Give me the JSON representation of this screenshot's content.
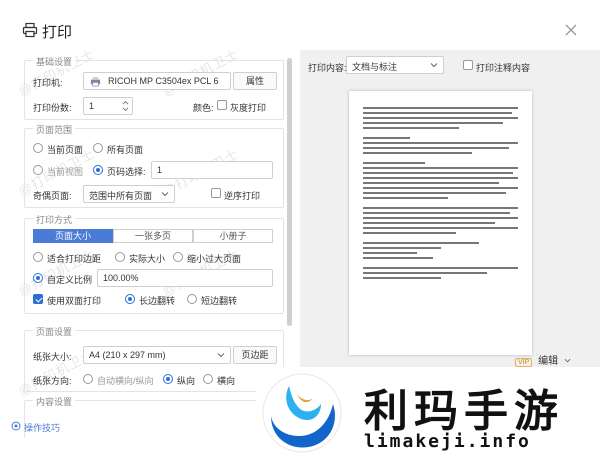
{
  "title": "打印",
  "watermark_text": "@打印机卫士",
  "basic": {
    "group_label": "基础设置",
    "printer_label": "打印机:",
    "printer_value": "RICOH MP C3504ex PCL 6",
    "properties_button": "属性",
    "copies_label": "打印份数:",
    "copies_value": "1",
    "color_label": "颜色:",
    "grayscale_label": "灰度打印",
    "grayscale_checked": false
  },
  "range": {
    "group_label": "页面范围",
    "current_page": "当前页面",
    "all_pages": "所有页面",
    "current_view": "当前视图",
    "page_select": "页码选择:",
    "page_select_value": "1",
    "selected": "page_select",
    "odd_even_label": "奇偶页面:",
    "odd_even_value": "范围中所有页面",
    "reverse_label": "逆序打印",
    "reverse_checked": false
  },
  "mode": {
    "group_label": "打印方式",
    "tabs": [
      "页面大小",
      "一张多页",
      "小册子"
    ],
    "active_tab": 0,
    "fit_margin": "适合打印边距",
    "actual_size": "实际大小",
    "shrink_oversize": "缩小过大页面",
    "custom_scale": "自定义比例",
    "custom_scale_value": "100.00%",
    "selected": "custom_scale",
    "duplex_label": "使用双面打印",
    "duplex_checked": true,
    "long_edge": "长边翻转",
    "short_edge": "短边翻转",
    "flip_selected": "long_edge"
  },
  "page_setup": {
    "group_label": "页面设置",
    "paper_size_label": "纸张大小:",
    "paper_size_value": "A4 (210 x 297 mm)",
    "margins_button": "页边距",
    "orientation_label": "纸张方向:",
    "auto_orientation": "自动横向/纵向",
    "portrait": "纵向",
    "landscape": "横向",
    "orientation_selected": "portrait"
  },
  "content_settings_label": "内容设置",
  "footer_link": "操作技巧",
  "preview": {
    "print_content_label": "打印内容:",
    "print_content_value": "文档与标注",
    "print_comments_label": "打印注释内容",
    "print_comments_checked": false,
    "edit_label": "编辑"
  },
  "overlay_logo": {
    "chinese": "利玛手游",
    "domain": "limakeji.info"
  },
  "colors": {
    "accent": "#2b6ed6",
    "tab_active": "#4a7bd6"
  }
}
